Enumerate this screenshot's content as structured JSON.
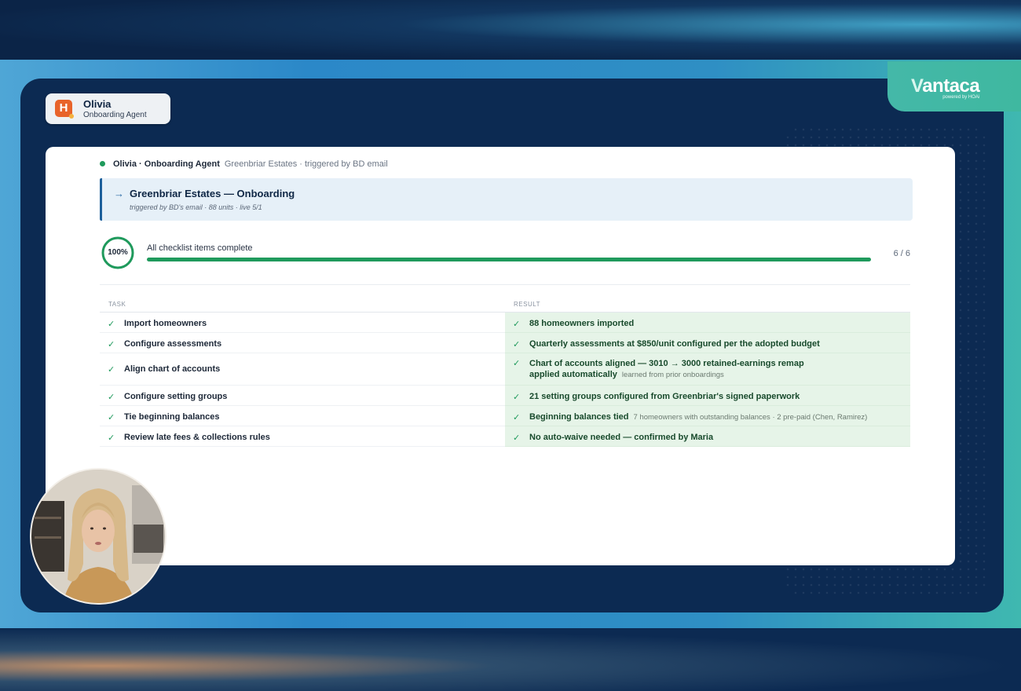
{
  "brand": {
    "name_v": "V",
    "name_rest": "antaca",
    "tagline": "powered by HOAi"
  },
  "agent_pill": {
    "avatar_letter": "H",
    "name": "Olivia",
    "role": "Onboarding Agent"
  },
  "status": {
    "agent": "Olivia · Onboarding Agent",
    "context": "Greenbriar Estates · triggered by BD email"
  },
  "banner": {
    "arrow": "→",
    "title": "Greenbriar Estates — Onboarding",
    "subtitle": "triggered by BD's email · 88 units · live 5/1"
  },
  "progress": {
    "percent_label": "100%",
    "fraction": 1.0,
    "label": "All checklist items complete",
    "count": "6 / 6"
  },
  "table": {
    "headers": {
      "task": "TASK",
      "result": "RESULT"
    },
    "check": "✓",
    "rows": [
      {
        "task": "Import homeowners",
        "result": "88 homeowners imported",
        "result_line2": "",
        "note": ""
      },
      {
        "task": "Configure assessments",
        "result": "Quarterly assessments at $850/unit configured per the adopted budget",
        "result_line2": "",
        "note": ""
      },
      {
        "task": "Align chart of accounts",
        "result": "Chart of accounts aligned — 3010 → 3000 retained-earnings remap",
        "result_line2": "applied automatically",
        "note": "learned from prior onboardings"
      },
      {
        "task": "Configure setting groups",
        "result": "21 setting groups configured from Greenbriar's signed paperwork",
        "result_line2": "",
        "note": ""
      },
      {
        "task": "Tie beginning balances",
        "result": "Beginning balances tied",
        "result_line2": "",
        "note": "7 homeowners with outstanding balances · 2 pre-paid (Chen, Ramirez)"
      },
      {
        "task": "Review late fees & collections rules",
        "result": " No auto-waive needed — confirmed by Maria",
        "result_line2": "",
        "note": ""
      }
    ]
  },
  "colors": {
    "accent_green": "#1f9a5c",
    "banner_blue": "#1d5f9b",
    "panel_navy": "#0c2a52",
    "agent_orange": "#e8632a"
  }
}
